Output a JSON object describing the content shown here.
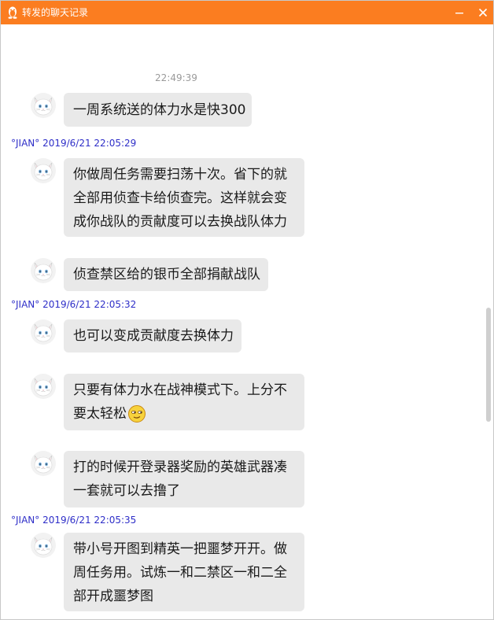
{
  "window": {
    "title": "转发的聊天记录",
    "minimize_label": "−",
    "close_label": "✕"
  },
  "timestamp": "22:49:39",
  "messages": [
    {
      "lines": [
        "一周系统送的体力水是快300"
      ]
    },
    {
      "sender": "°JIAN° 2019/6/21 22:05:29",
      "lines": [
        "你做周任务需要扫荡十次。省下的就",
        "全部用侦查卡给侦查完。这样就会变",
        "成你战队的贡献度可以去换战队体力"
      ]
    },
    {
      "lines": [
        "侦查禁区给的银币全部捐献战队"
      ]
    },
    {
      "sender": "°JIAN° 2019/6/21 22:05:32",
      "lines": [
        "也可以变成贡献度去换体力"
      ]
    },
    {
      "lines": [
        "只要有体力水在战神模式下。上分不",
        "要太轻松"
      ]
    },
    {
      "lines": [
        "打的时候开登录器奖励的英雄武器凑",
        "一套就可以去撸了"
      ]
    },
    {
      "sender": "°JIAN° 2019/6/21 22:05:35",
      "lines": [
        "带小号开图到精英一把噩梦开开。做",
        "周任务用。试炼一和二禁区一和二全",
        "部开成噩梦图"
      ]
    }
  ],
  "colors": {
    "titlebar": "#fb7d20",
    "bubble": "#e9e9e9",
    "sender": "#2e2ec8"
  },
  "icons": {
    "title": "penguin-icon",
    "emoji": "smirk-emoji-icon"
  }
}
